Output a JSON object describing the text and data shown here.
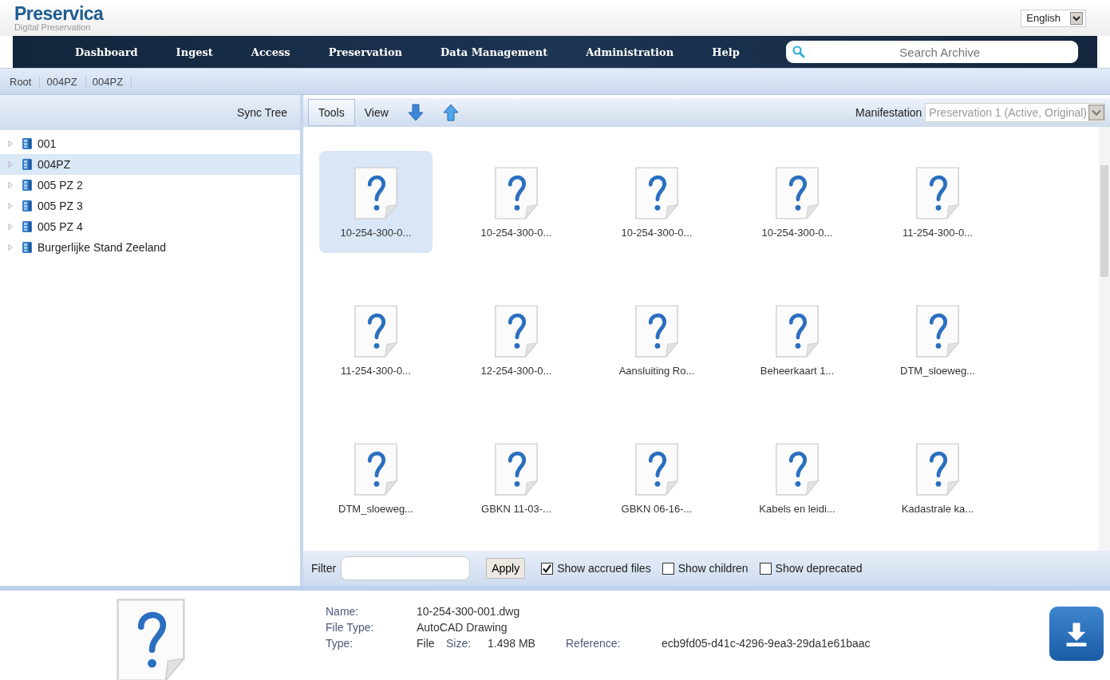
{
  "logo": {
    "title": "Preservica",
    "subtitle": "Digital Preservation"
  },
  "language": {
    "value": "English"
  },
  "nav": [
    {
      "label": "Dashboard"
    },
    {
      "label": "Ingest"
    },
    {
      "label": "Access"
    },
    {
      "label": "Preservation"
    },
    {
      "label": "Data Management"
    },
    {
      "label": "Administration"
    },
    {
      "label": "Help"
    }
  ],
  "search": {
    "placeholder": "Search Archive"
  },
  "breadcrumb": [
    "Root",
    "004PZ",
    "004PZ"
  ],
  "tree": {
    "sync_label": "Sync Tree",
    "items": [
      {
        "label": "001",
        "selected": false
      },
      {
        "label": "004PZ",
        "selected": true
      },
      {
        "label": "005 PZ 2",
        "selected": false
      },
      {
        "label": "005 PZ 3",
        "selected": false
      },
      {
        "label": "005 PZ 4",
        "selected": false
      },
      {
        "label": "Burgerlijke Stand Zeeland",
        "selected": false
      }
    ]
  },
  "toolbar": {
    "tabs": [
      {
        "label": "Tools",
        "selected": true
      },
      {
        "label": "View",
        "selected": false
      }
    ],
    "manifestation_label": "Manifestation",
    "manifestation_value": "Preservation 1 (Active, Original)"
  },
  "files": [
    {
      "name": "10-254-300-0...",
      "selected": true
    },
    {
      "name": "10-254-300-0...",
      "selected": false
    },
    {
      "name": "10-254-300-0...",
      "selected": false
    },
    {
      "name": "10-254-300-0...",
      "selected": false
    },
    {
      "name": "11-254-300-0...",
      "selected": false
    },
    {
      "name": "11-254-300-0...",
      "selected": false
    },
    {
      "name": "12-254-300-0...",
      "selected": false
    },
    {
      "name": "Aansluiting Ro...",
      "selected": false
    },
    {
      "name": "Beheerkaart 1...",
      "selected": false
    },
    {
      "name": "DTM_sloeweg...",
      "selected": false
    },
    {
      "name": "DTM_sloeweg...",
      "selected": false
    },
    {
      "name": "GBKN 11-03-...",
      "selected": false
    },
    {
      "name": "GBKN 06-16-...",
      "selected": false
    },
    {
      "name": "Kabels en leidi...",
      "selected": false
    },
    {
      "name": "Kadastrale ka...",
      "selected": false
    }
  ],
  "filter": {
    "label": "Filter",
    "apply": "Apply",
    "options": [
      {
        "label": "Show accrued files",
        "checked": true
      },
      {
        "label": "Show children",
        "checked": false
      },
      {
        "label": "Show deprecated",
        "checked": false
      }
    ]
  },
  "details": {
    "name_label": "Name:",
    "name": "10-254-300-001.dwg",
    "filetype_label": "File Type:",
    "filetype": "AutoCAD Drawing",
    "type_label": "Type:",
    "type": "File",
    "size_label": "Size:",
    "size": "1.498 MB",
    "reference_label": "Reference:",
    "reference": "ecb9fd05-d41c-4296-9ea3-29da1e61baac"
  }
}
